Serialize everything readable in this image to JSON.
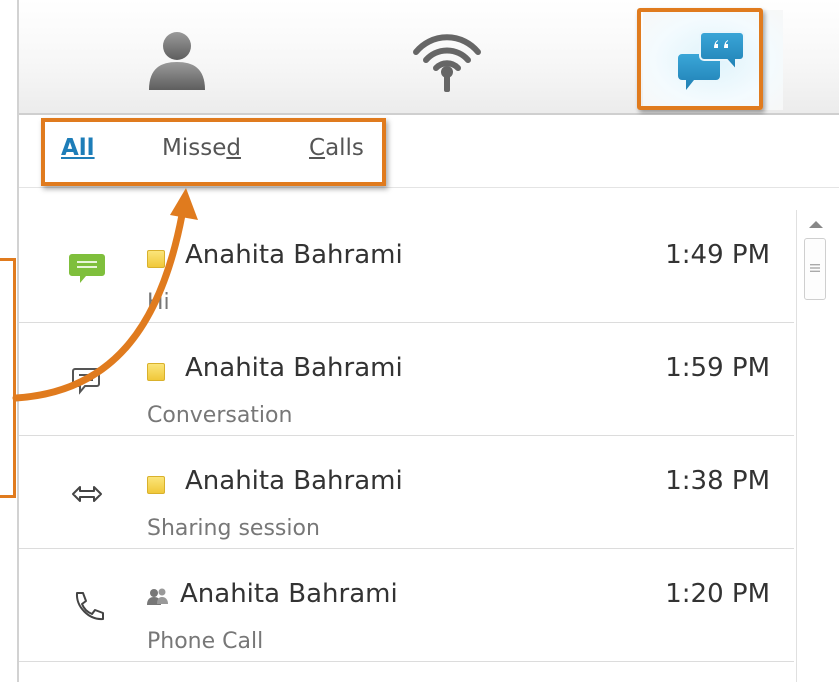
{
  "toolbar": {
    "items": [
      {
        "name": "contacts",
        "icon": "person-icon"
      },
      {
        "name": "presence",
        "icon": "broadcast-icon"
      },
      {
        "name": "conversations",
        "icon": "chat-bubbles-icon"
      }
    ]
  },
  "tabs": {
    "all": "All",
    "missed": {
      "prefix": "Misse",
      "underlined": "d"
    },
    "calls": {
      "underlined": "C",
      "suffix": "alls"
    }
  },
  "conversations": [
    {
      "name": "Anahita Bahrami",
      "time": "1:49 PM",
      "subtitle": "Hi",
      "type_icon": "chat-message-icon",
      "presence": "away"
    },
    {
      "name": "Anahita Bahrami",
      "time": "1:59 PM",
      "subtitle": "Conversation",
      "type_icon": "conversation-icon",
      "presence": "away"
    },
    {
      "name": "Anahita Bahrami",
      "time": "1:38 PM",
      "subtitle": "Sharing session",
      "type_icon": "sharing-arrows-icon",
      "presence": "away"
    },
    {
      "name": "Anahita Bahrami",
      "time": "1:20 PM",
      "subtitle": "Phone Call",
      "type_icon": "phone-icon",
      "presence": "group"
    }
  ],
  "colors": {
    "accent_tab": "#1d7db8",
    "annotation": "#e07b1e",
    "presence_away": "#f0c83a",
    "message_icon": "#7fbf3c",
    "chat_blue": "#2a8fc4"
  }
}
